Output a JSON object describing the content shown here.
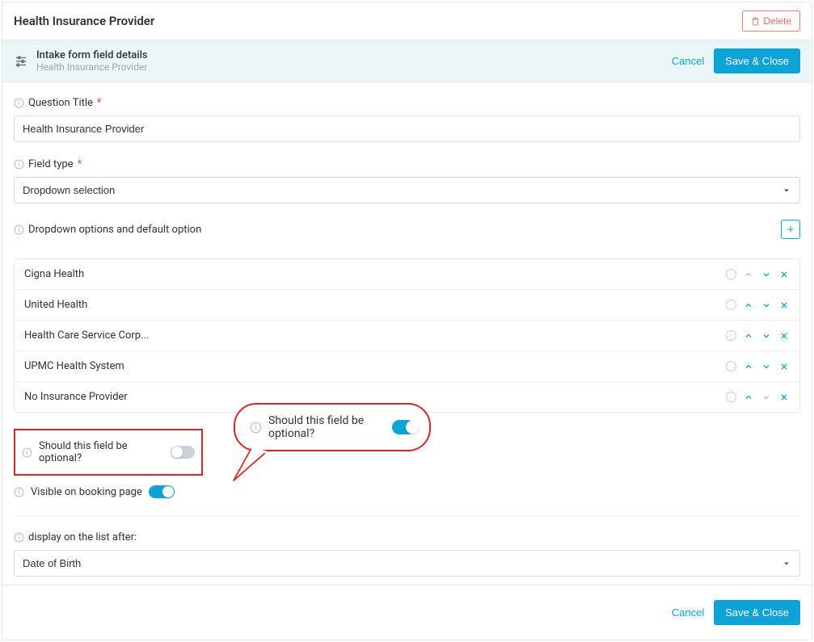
{
  "header": {
    "title": "Health Insurance Provider",
    "delete_label": "Delete"
  },
  "subheader": {
    "title": "Intake form field details",
    "subtitle": "Health Insurance Provider",
    "cancel_label": "Cancel",
    "save_label": "Save & Close"
  },
  "fields": {
    "question_title": {
      "label": "Question Title",
      "required": "*",
      "value": "Health Insurance Provider"
    },
    "field_type": {
      "label": "Field type",
      "required": "*",
      "value": "Dropdown selection"
    },
    "dropdown_options": {
      "label": "Dropdown options and default option",
      "add_label": "+",
      "items": [
        {
          "text": "Cigna Health",
          "up_muted": true,
          "down_muted": false
        },
        {
          "text": "United Health",
          "up_muted": false,
          "down_muted": false
        },
        {
          "text": "Health Care Service Corp...",
          "up_muted": false,
          "down_muted": false
        },
        {
          "text": "UPMC Health System",
          "up_muted": false,
          "down_muted": false
        },
        {
          "text": "No Insurance Provider",
          "up_muted": false,
          "down_muted": true
        }
      ]
    },
    "optional_toggle": {
      "label": "Should this field be optional?",
      "on": false
    },
    "visible_toggle": {
      "label": "Visible on booking page",
      "on": true
    },
    "display_after": {
      "label": "display on the list after:",
      "value": "Date of Birth"
    }
  },
  "callout": {
    "label": "Should this field be optional?"
  },
  "footer": {
    "cancel_label": "Cancel",
    "save_label": "Save & Close"
  }
}
